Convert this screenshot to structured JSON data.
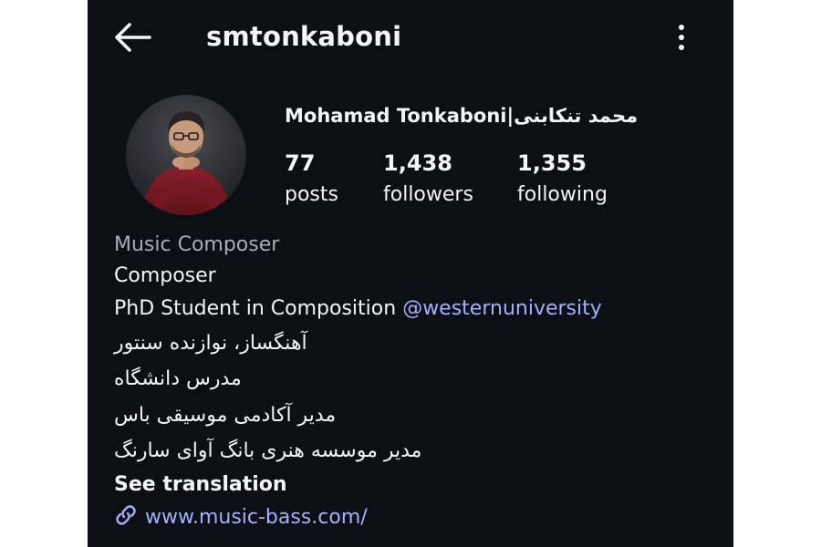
{
  "header": {
    "username": "smtonkaboni",
    "back_icon": "arrow-left-icon",
    "menu_icon": "more-vertical-icon"
  },
  "profile": {
    "full_name": "Mohamad Tonkaboni|محمد تنکابنی",
    "stats": [
      {
        "value": "77",
        "label": "posts"
      },
      {
        "value": "1,438",
        "label": "followers"
      },
      {
        "value": "1,355",
        "label": "following"
      }
    ]
  },
  "bio": {
    "category": "Music Composer",
    "line1": "Composer",
    "line2_text": "PhD Student in Composition ",
    "line2_mention": "@westernuniversity",
    "fa_lines": [
      "آهنگساز، نوازنده سنتور",
      "مدرس دانشگاه",
      "مدیر آکادمی موسیقی باس",
      "مدیر موسسه هنری بانگ آوای سارنگ"
    ],
    "see_translation": "See translation",
    "link": "www.music-bass.com/",
    "link_icon": "link-icon"
  },
  "colors": {
    "background": "#0c1015",
    "text": "#f3f5f7",
    "muted": "#a8acb3",
    "link": "#a3b0ff"
  }
}
